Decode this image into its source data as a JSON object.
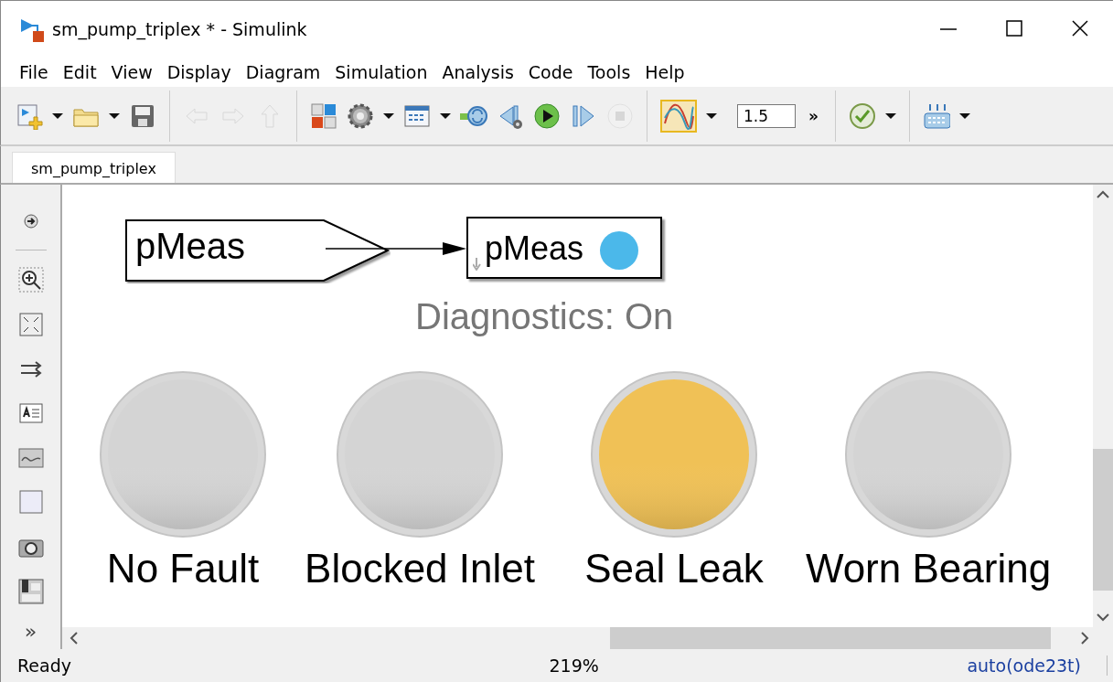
{
  "window": {
    "title": "sm_pump_triplex * - Simulink"
  },
  "menu": [
    "File",
    "Edit",
    "View",
    "Display",
    "Diagram",
    "Simulation",
    "Analysis",
    "Code",
    "Tools",
    "Help"
  ],
  "toolbar": [
    {
      "kind": "new",
      "disabled": false,
      "dropdown": true
    },
    {
      "kind": "open",
      "disabled": false,
      "dropdown": true
    },
    {
      "kind": "save",
      "disabled": false,
      "dropdown": false
    },
    {
      "kind": "separator"
    },
    {
      "kind": "back",
      "disabled": true,
      "dropdown": false
    },
    {
      "kind": "forward",
      "disabled": true,
      "dropdown": false
    },
    {
      "kind": "up",
      "disabled": true,
      "dropdown": false
    },
    {
      "kind": "separator"
    },
    {
      "kind": "library",
      "disabled": false,
      "dropdown": false
    },
    {
      "kind": "settings",
      "disabled": false,
      "dropdown": true
    },
    {
      "kind": "explorer",
      "disabled": false,
      "dropdown": true
    },
    {
      "kind": "fast-restart",
      "disabled": false,
      "dropdown": false
    },
    {
      "kind": "step-back",
      "disabled": false,
      "dropdown": false
    },
    {
      "kind": "run",
      "disabled": false,
      "dropdown": false
    },
    {
      "kind": "step-forward",
      "disabled": false,
      "dropdown": false
    },
    {
      "kind": "stop",
      "disabled": true,
      "dropdown": false
    },
    {
      "kind": "separator"
    },
    {
      "kind": "scope",
      "disabled": false,
      "dropdown": true,
      "on": true
    },
    {
      "kind": "field",
      "value": "1.5"
    },
    {
      "kind": "more",
      "text": "»"
    },
    {
      "kind": "separator"
    },
    {
      "kind": "check",
      "disabled": false,
      "dropdown": true
    },
    {
      "kind": "separator"
    },
    {
      "kind": "build",
      "disabled": false,
      "dropdown": true
    }
  ],
  "tabs": [
    {
      "label": "sm_pump_triplex",
      "selected": true
    }
  ],
  "palette": {
    "more": "»"
  },
  "canvas": {
    "goto_block": {
      "label": "pMeas"
    },
    "from_block": {
      "label": "pMeas",
      "indicator_dot": {
        "color": "#4bb8ea"
      }
    },
    "diagnostics": "Diagnostics: On",
    "lamps": [
      {
        "label": "No Fault",
        "color": "#d4d4d4"
      },
      {
        "label": "Blocked Inlet",
        "color": "#d4d4d4"
      },
      {
        "label": "Seal Leak",
        "color": "#f0c156"
      },
      {
        "label": "Worn Bearing",
        "color": "#d4d4d4"
      }
    ]
  },
  "status_bar": {
    "state": "Ready",
    "zoom": "219%",
    "solver": "auto(ode23t)"
  }
}
